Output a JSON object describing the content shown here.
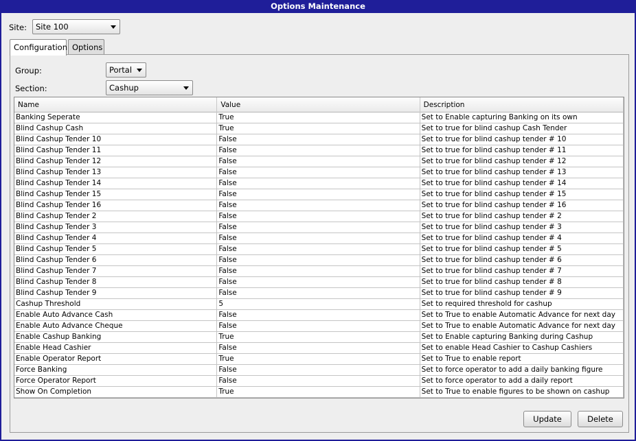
{
  "window": {
    "title": "Options Maintenance"
  },
  "site": {
    "label": "Site:",
    "value": "Site 100"
  },
  "tabs": [
    {
      "label": "Configuration"
    },
    {
      "label": "Options"
    }
  ],
  "group": {
    "label": "Group:",
    "value": "Portal"
  },
  "section": {
    "label": "Section:",
    "value": "Cashup"
  },
  "table": {
    "columns": [
      "Name",
      "Value",
      "Description"
    ],
    "rows": [
      [
        "Banking Seperate",
        "True",
        "Set to Enable capturing Banking on its own"
      ],
      [
        "Blind Cashup Cash",
        "True",
        "Set to true for blind cashup Cash Tender"
      ],
      [
        "Blind Cashup Tender 10",
        "False",
        "Set to true for blind cashup tender # 10"
      ],
      [
        "Blind Cashup Tender 11",
        "False",
        "Set to true for blind cashup tender # 11"
      ],
      [
        "Blind Cashup Tender 12",
        "False",
        "Set to true for blind cashup tender # 12"
      ],
      [
        "Blind Cashup Tender 13",
        "False",
        "Set to true for blind cashup tender # 13"
      ],
      [
        "Blind Cashup Tender 14",
        "False",
        "Set to true for blind cashup tender # 14"
      ],
      [
        "Blind Cashup Tender 15",
        "False",
        "Set to true for blind cashup tender # 15"
      ],
      [
        "Blind Cashup Tender 16",
        "False",
        "Set to true for blind cashup tender # 16"
      ],
      [
        "Blind Cashup Tender 2",
        "False",
        "Set to true for blind cashup tender # 2"
      ],
      [
        "Blind Cashup Tender 3",
        "False",
        "Set to true for blind cashup tender # 3"
      ],
      [
        "Blind Cashup Tender 4",
        "False",
        "Set to true for blind cashup tender # 4"
      ],
      [
        "Blind Cashup Tender 5",
        "False",
        "Set to true for blind cashup tender # 5"
      ],
      [
        "Blind Cashup Tender 6",
        "False",
        "Set to true for blind cashup tender # 6"
      ],
      [
        "Blind Cashup Tender 7",
        "False",
        "Set to true for blind cashup tender # 7"
      ],
      [
        "Blind Cashup Tender 8",
        "False",
        "Set to true for blind cashup tender # 8"
      ],
      [
        "Blind Cashup Tender 9",
        "False",
        "Set to true for blind cashup tender # 9"
      ],
      [
        "Cashup Threshold",
        "5",
        "Set to required threshold for cashup"
      ],
      [
        "Enable Auto Advance Cash",
        "False",
        "Set to True to enable Automatic Advance for next day"
      ],
      [
        "Enable Auto Advance Cheque",
        "False",
        "Set to True to enable Automatic Advance for next day"
      ],
      [
        "Enable Cashup Banking",
        "True",
        "Set to Enable capturing Banking during Cashup"
      ],
      [
        "Enable Head Cashier",
        "False",
        "Set to enable Head Cashier to Cashup Cashiers"
      ],
      [
        "Enable Operator Report",
        "True",
        "Set to True to enable report"
      ],
      [
        "Force Banking",
        "False",
        "Set to force operator to add a daily banking figure"
      ],
      [
        "Force Operator Report",
        "False",
        "Set to force operator to add a daily report"
      ],
      [
        "Show On Completion",
        "True",
        "Set to True to enable figures to be shown on cashup"
      ]
    ]
  },
  "buttons": {
    "update": "Update",
    "delete": "Delete"
  }
}
